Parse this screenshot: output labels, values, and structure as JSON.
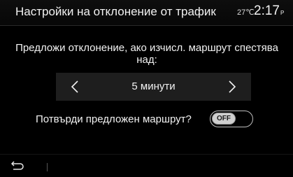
{
  "header": {
    "title": "Настройки на отклонение от трафик",
    "temperature": "27℃",
    "time": "2:17",
    "ampm": "P"
  },
  "main": {
    "question": "Предложи отклонение, ако изчисл. маршрут спестява над:",
    "selector": {
      "value": "5 минути",
      "prev_icon": "chevron-left-icon",
      "next_icon": "chevron-right-icon"
    },
    "confirm": {
      "label": "Потвърди предложен маршрут?",
      "toggle_state": "OFF"
    }
  },
  "footer": {
    "back_icon": "back-arrow-icon"
  },
  "colors": {
    "background": "#000000",
    "selector_bg": "#1e1e1e",
    "text": "#f2f2f2"
  }
}
